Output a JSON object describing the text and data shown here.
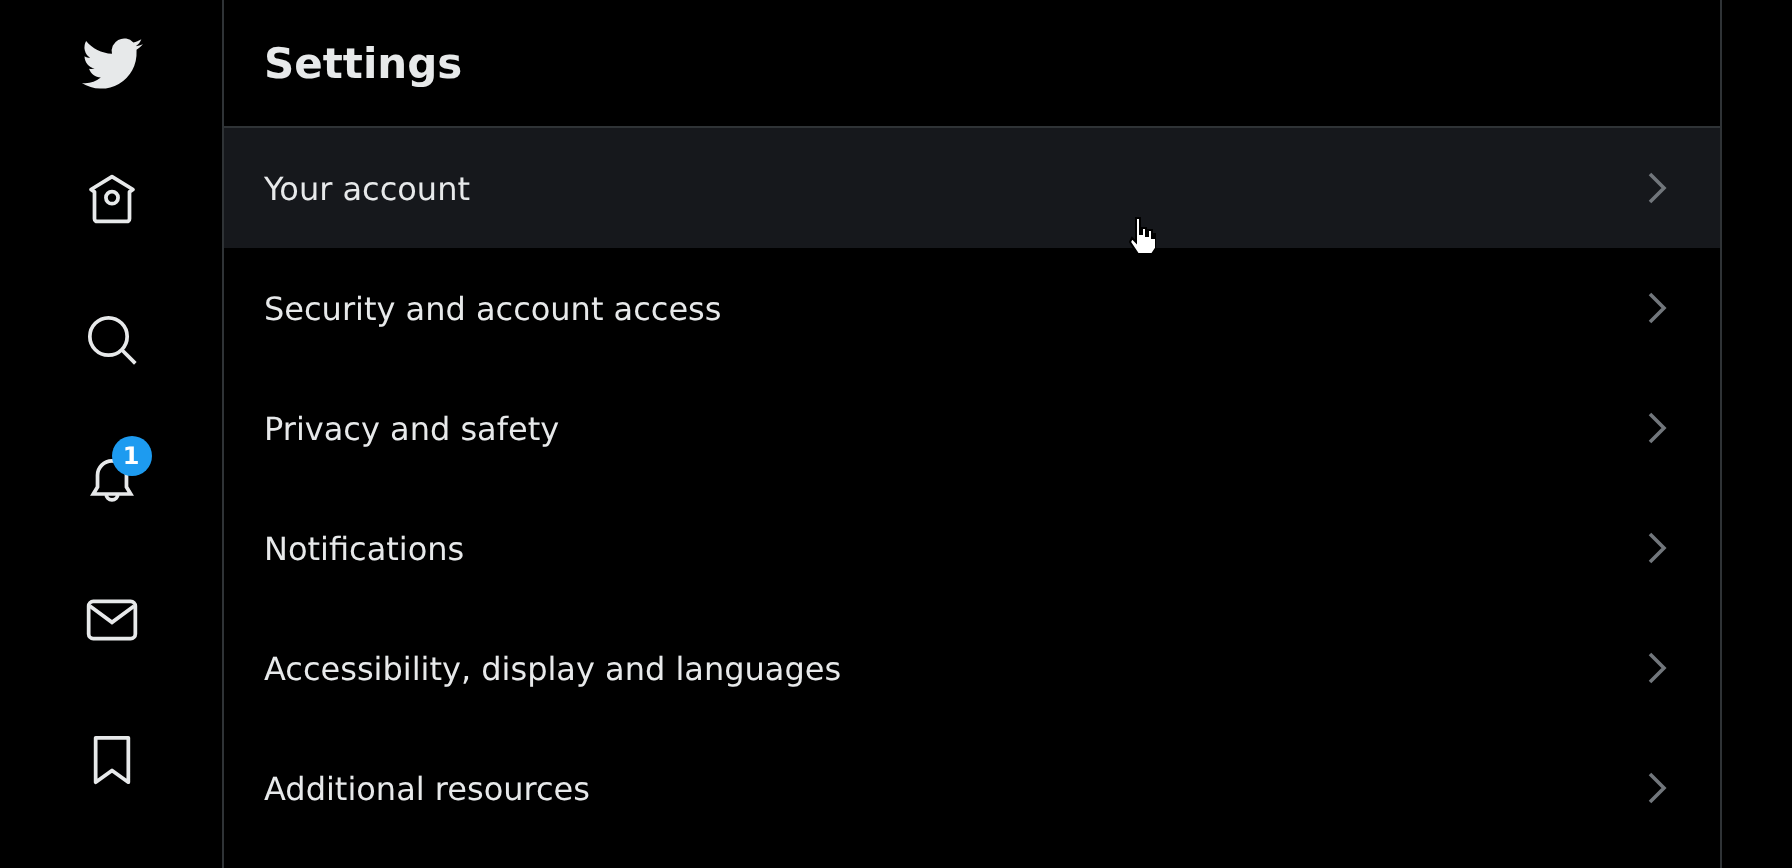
{
  "sidebar": {
    "items": [
      {
        "kind": "logo"
      },
      {
        "kind": "home"
      },
      {
        "kind": "explore"
      },
      {
        "kind": "notifications",
        "badge": "1"
      },
      {
        "kind": "messages"
      },
      {
        "kind": "bookmarks"
      }
    ]
  },
  "settings": {
    "title": "Settings",
    "items": [
      {
        "label": "Your account",
        "hovered": true
      },
      {
        "label": "Security and account access",
        "hovered": false
      },
      {
        "label": "Privacy and safety",
        "hovered": false
      },
      {
        "label": "Notifications",
        "hovered": false
      },
      {
        "label": "Accessibility, display and languages",
        "hovered": false
      },
      {
        "label": "Additional resources",
        "hovered": false
      }
    ]
  }
}
